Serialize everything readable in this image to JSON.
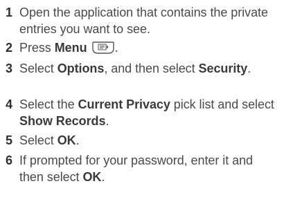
{
  "steps": [
    {
      "number": "1",
      "parts": [
        "Open the application that contains the private entries you want to see."
      ]
    },
    {
      "number": "2",
      "parts": [
        "Press ",
        "Menu",
        "."
      ],
      "icon": "menu-key-icon"
    },
    {
      "number": "3",
      "parts": [
        "Select ",
        "Options",
        ", and then select ",
        "Security",
        "."
      ]
    },
    {
      "number": "4",
      "parts": [
        "Select the ",
        "Current Privacy",
        " pick list and select ",
        "Show Records",
        "."
      ]
    },
    {
      "number": "5",
      "parts": [
        "Select ",
        "OK",
        "."
      ]
    },
    {
      "number": "6",
      "parts": [
        "If prompted for your password, enter it and then select ",
        "OK",
        "."
      ]
    }
  ]
}
